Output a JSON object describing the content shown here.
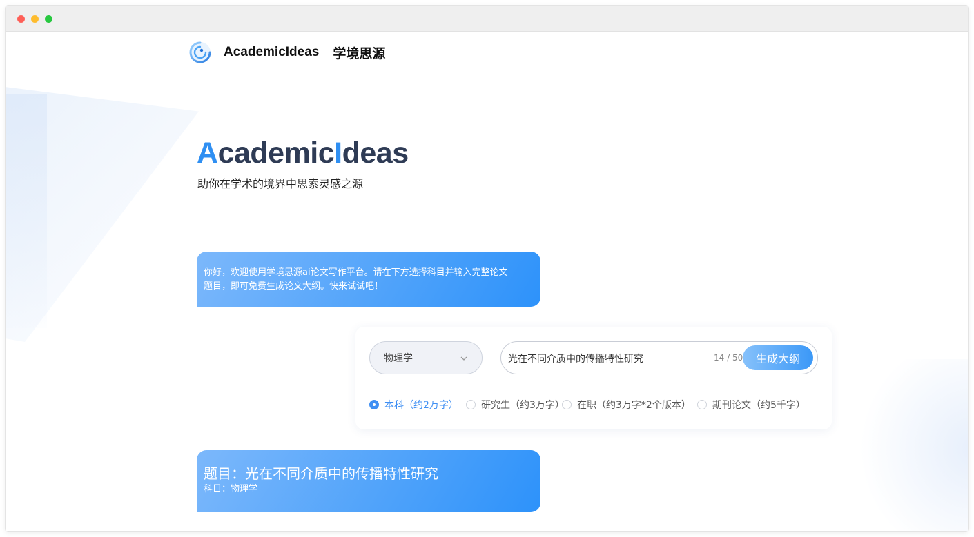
{
  "header": {
    "brand_en": "AcademicIdeas",
    "brand_cn": "学境思源"
  },
  "hero": {
    "title_first_letter": "A",
    "title_part1": "cademic",
    "title_accent_letter": "I",
    "title_part2": "deas",
    "subtitle": "助你在学术的境界中思索灵感之源"
  },
  "welcome_message": {
    "line1": "你好，欢迎使用学境思源ai论文写作平台。请在下方选择科目并输入完整论文",
    "line2": "题目，即可免费生成论文大纲。快来试试吧！"
  },
  "form": {
    "subject_value": "物理学",
    "topic_value": "光在不同介质中的传播特性研究",
    "counter": "14 / 50",
    "generate_label": "生成大纲",
    "levels": [
      {
        "label": "本科（约2万字）",
        "selected": true
      },
      {
        "label": "研究生（约3万字）",
        "selected": false
      },
      {
        "label": "在职（约3万字*2个版本）",
        "selected": false
      },
      {
        "label": "期刊论文（约5千字）",
        "selected": false
      }
    ]
  },
  "result": {
    "topic_line": "题目：光在不同介质中的传播特性研究",
    "subject_line": "科目：物理学"
  },
  "colors": {
    "accent": "#2f8ff2",
    "title_dark": "#2e3b55",
    "bubble_start": "#7cb8fb",
    "bubble_end": "#2d92fa"
  },
  "icons": {
    "logo": "swirl-logo-icon",
    "select_arrow": "chevron-down-icon"
  }
}
